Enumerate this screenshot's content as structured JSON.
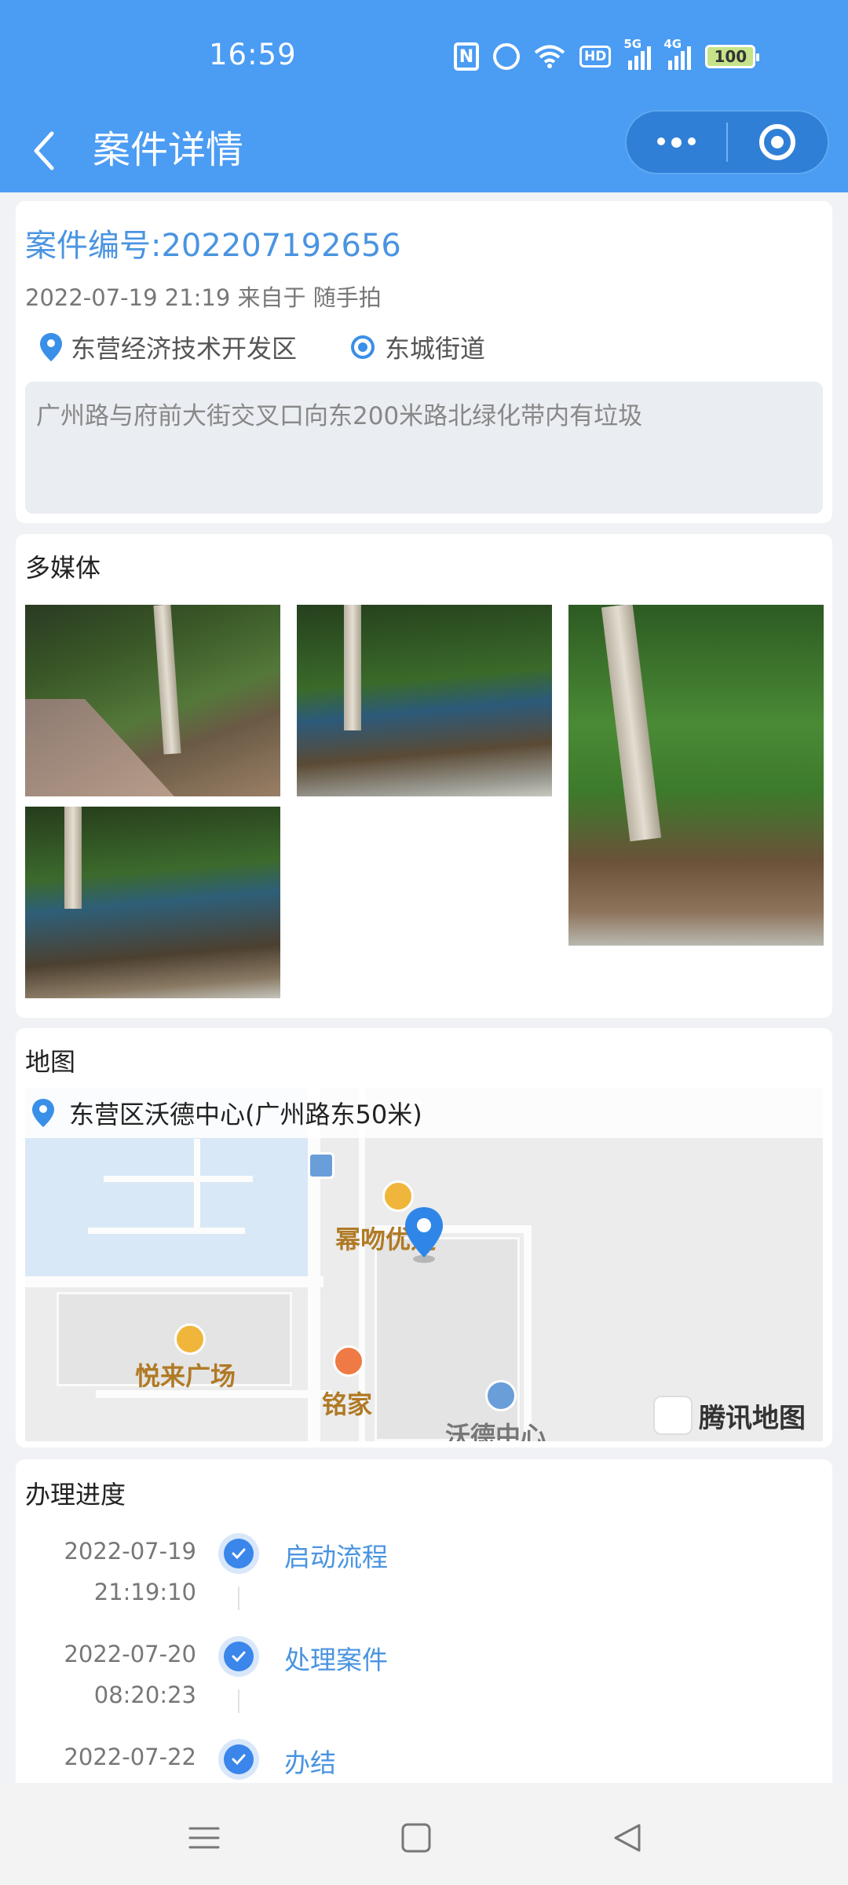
{
  "status_bar": {
    "time": "16:59",
    "signal_5g": "5G",
    "signal_4g": "4G",
    "hd": "HD",
    "battery": "100"
  },
  "navbar": {
    "title": "案件详情"
  },
  "case": {
    "number": "案件编号:202207192656",
    "meta": "2022-07-19 21:19 来自于 随手拍",
    "district": "东营经济技术开发区",
    "street": "东城街道",
    "description": "广州路与府前大街交叉口向东200米路北绿化带内有垃圾"
  },
  "media": {
    "title": "多媒体"
  },
  "map": {
    "title": "地图",
    "address": "东营区沃德中心(广州路东50米)",
    "labels": [
      "幂吻优选",
      "悦来广场",
      "铭家",
      "沃德中心"
    ],
    "brand": "腾讯地图"
  },
  "progress": {
    "title": "办理进度",
    "steps": [
      {
        "date": "2022-07-19",
        "time": "21:19:10",
        "name": "启动流程"
      },
      {
        "date": "2022-07-20",
        "time": "08:20:23",
        "name": "处理案件"
      },
      {
        "date": "2022-07-22",
        "time": "",
        "name": "办结"
      }
    ]
  },
  "colors": {
    "header": "#4b9cf3",
    "accent": "#4a94e0",
    "step_dot": "#3a86ea"
  }
}
